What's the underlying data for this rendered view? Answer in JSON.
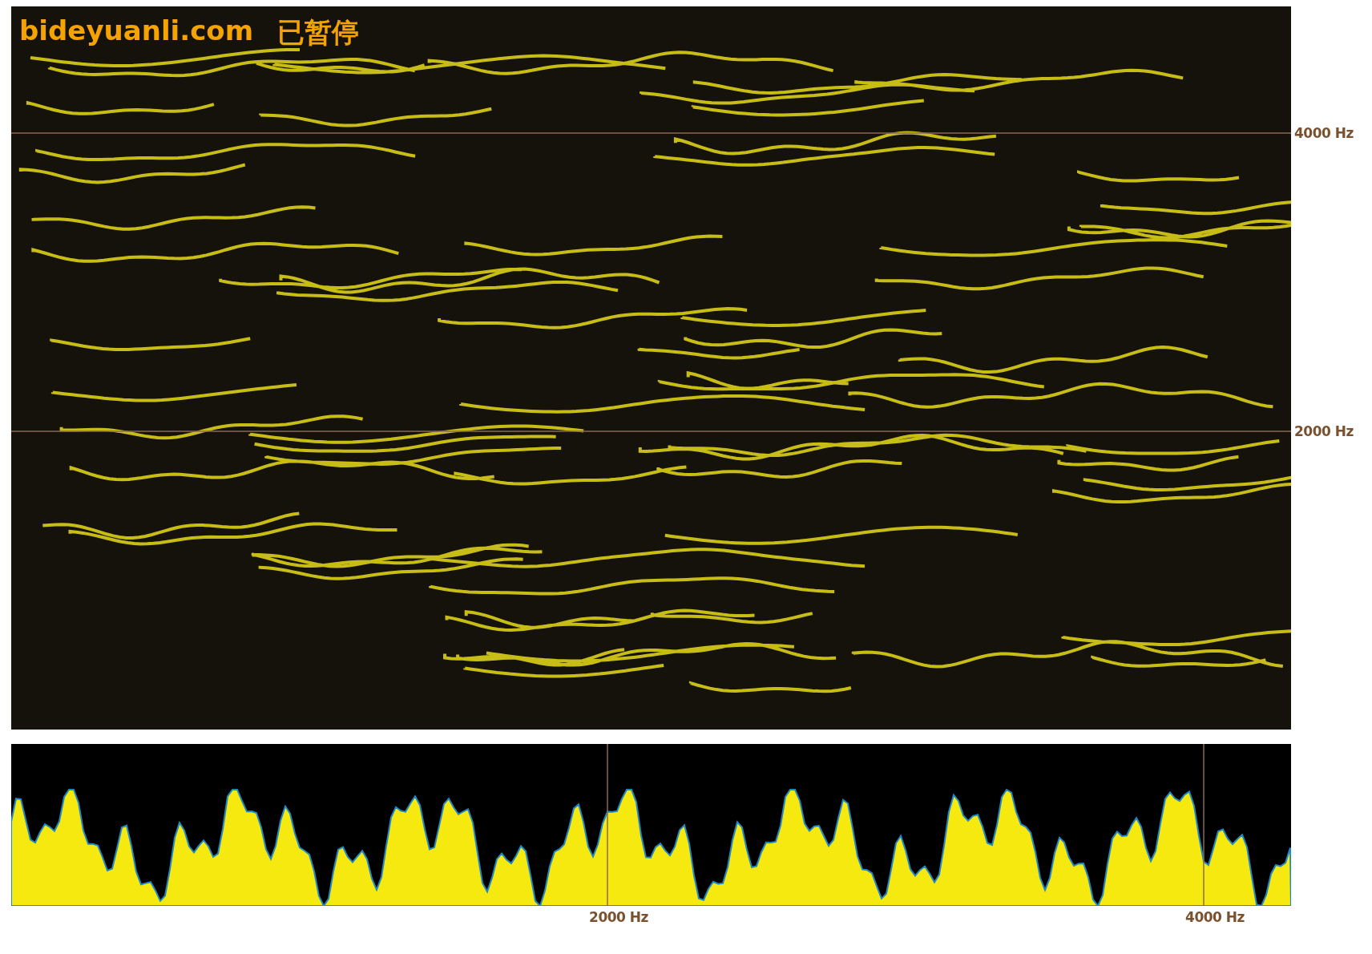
{
  "overlay": {
    "site": "bideyuanli.com",
    "status": "已暂停"
  },
  "spectrogram": {
    "axis_labels": [
      "4000 Hz",
      "2000 Hz"
    ]
  },
  "spectrum": {
    "axis_labels": [
      "2000 Hz",
      "4000 Hz"
    ]
  }
}
